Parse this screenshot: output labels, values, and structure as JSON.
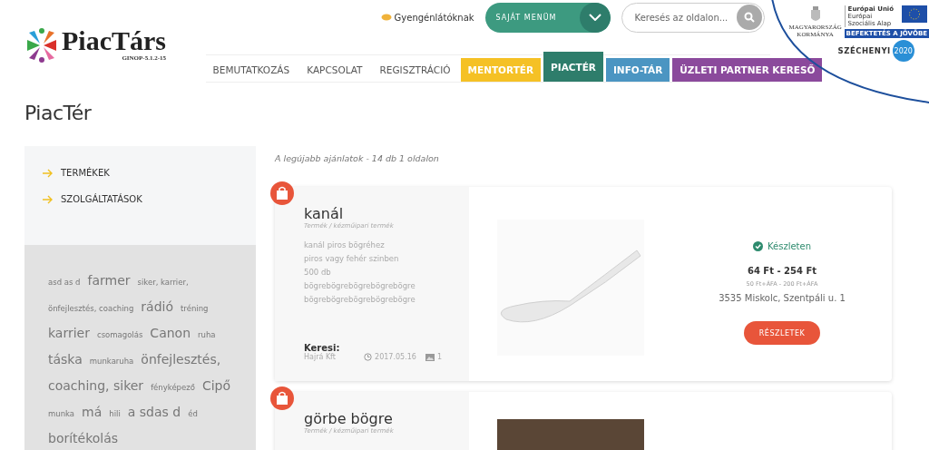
{
  "header": {
    "logo": {
      "name": "PiacTárs",
      "code": "GINOP-5.1.2-15"
    },
    "accessibility_link": "Gyengénlátóknak",
    "my_menu": "SAJÁT MENÜM",
    "search": {
      "placeholder": "Keresés az oldalon..."
    },
    "sponsors": {
      "government": "MAGYARORSZÁG KORMÁNYA",
      "eu_title": "Európai Unió",
      "eu_fund": "Európai Szociális Alap",
      "eu_slogan": "BEFEKTETÉS A JÖVŐBE",
      "szechenyi": "SZÉCHENYI",
      "szechenyi_year": "2020"
    },
    "nav": [
      {
        "label": "BEMUTATKOZÁS",
        "selected": false
      },
      {
        "label": "KAPCSOLAT",
        "selected": false
      },
      {
        "label": "REGISZTRÁCIÓ",
        "selected": false
      },
      {
        "label": "MENTORTÉR",
        "selected": false,
        "color": "#f5c125"
      },
      {
        "label": "PIACTÉR",
        "selected": true,
        "color": "#2e7d6b"
      },
      {
        "label": "INFO-TÁR",
        "selected": false,
        "color": "#4b95c2"
      },
      {
        "label": "ÜZLETI PARTNER KERESŐ",
        "selected": false,
        "color": "#8b4a9c"
      }
    ]
  },
  "page_title": "PiacTér",
  "sidebar": {
    "categories": [
      "TERMÉKEK",
      "SZOLGÁLTATÁSOK"
    ],
    "tags": [
      {
        "label": "asd as d",
        "kind": "small"
      },
      {
        "label": "farmer",
        "kind": "large"
      },
      {
        "label": "siker, karrier,",
        "kind": "small"
      },
      {
        "label": "önfejlesztés, coaching",
        "kind": "small"
      },
      {
        "label": "rádió",
        "kind": "large"
      },
      {
        "label": "tréning",
        "kind": "small"
      },
      {
        "label": "karrier",
        "kind": "large"
      },
      {
        "label": "csomagolás",
        "kind": "small"
      },
      {
        "label": "Canon",
        "kind": "large"
      },
      {
        "label": "ruha",
        "kind": "small"
      },
      {
        "label": "táska",
        "kind": "large"
      },
      {
        "label": "munkaruha",
        "kind": "small"
      },
      {
        "label": "önfejlesztés,",
        "kind": "large"
      },
      {
        "label": "coaching, siker",
        "kind": "large"
      },
      {
        "label": "fényképező",
        "kind": "small"
      },
      {
        "label": "Cipő",
        "kind": "large"
      },
      {
        "label": "munka",
        "kind": "small"
      },
      {
        "label": "má",
        "kind": "large"
      },
      {
        "label": "hili",
        "kind": "small"
      },
      {
        "label": "a sdas d",
        "kind": "large"
      },
      {
        "label": "éd",
        "kind": "small"
      },
      {
        "label": "borítékolás",
        "kind": "large"
      }
    ]
  },
  "listing": {
    "summary": "A legújabb ajánlatok - 14 db 1 oldalon",
    "offers": [
      {
        "title": "kanál",
        "category": "Termék / kézműipari termék",
        "description": [
          "kanál piros bögréhez",
          "piros vagy fehér szinben",
          "500 db",
          "bögrebögrebögrebögrebögre",
          "bögrebögrebögrebögrebögre"
        ],
        "seeker_label": "Keresi:",
        "seeker": "Hajrá Kft",
        "date": "2017.05.16",
        "images": "1",
        "stock": "Készleten",
        "price": "64 Ft - 254 Ft",
        "net_price": "50 Ft+ÁFA - 200 Ft+ÁFA",
        "address": "3535 Miskolc, Szentpáli u. 1",
        "button": "RÉSZLETEK"
      },
      {
        "title": "görbe bögre",
        "category": "Termék / kézműipari termék"
      }
    ]
  }
}
